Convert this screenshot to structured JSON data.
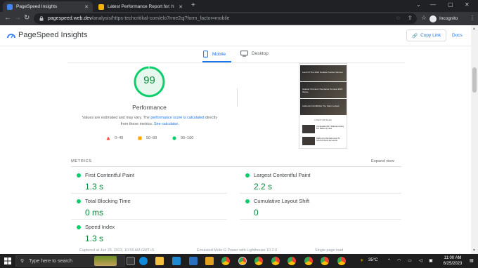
{
  "browser": {
    "tabs": [
      {
        "title": "PageSpeed Insights",
        "active": true
      },
      {
        "title": "Latest Performance Report for: h",
        "active": false
      }
    ],
    "url_host": "pagespeed.web.dev",
    "url_path": "/analysis/https-techcritikal-com/elo7rme2qj?form_factor=mobile",
    "profile_label": "Incognito"
  },
  "header": {
    "title": "PageSpeed Insights",
    "copy_link": "Copy Link",
    "docs": "Docs"
  },
  "device_tabs": {
    "mobile": "Mobile",
    "desktop": "Desktop"
  },
  "score": {
    "value": "99",
    "fraction": 0.99,
    "label": "Performance",
    "disclaimer_a": "Values are estimated and may vary. The ",
    "disclaimer_link1": "performance score is calculated",
    "disclaimer_b": " directly from these metrics. ",
    "disclaimer_link2": "See calculator.",
    "legend": [
      {
        "range": "0–49",
        "color": "#ff4e42"
      },
      {
        "range": "50–89",
        "color": "#ffa400"
      },
      {
        "range": "90–100",
        "color": "#0cce6b"
      }
    ]
  },
  "screenshot": {
    "cards": [
      "Land Of The 2023 Notable Positive Women",
      "Snarker Premium The Game To Face 2023 Series",
      "Authentic DroidMode The Stars Locked"
    ],
    "latest_label": "LATEST ARTICLES",
    "articles": [
      "Unmissable 2017 Pakistan Liberty Pro Slides Up Here",
      "Taking It to the Next Level To Arrive At Score As Low As"
    ]
  },
  "metrics": {
    "label": "METRICS",
    "expand": "Expand view",
    "items": [
      {
        "name": "First Contentful Paint",
        "value": "1.3 s"
      },
      {
        "name": "Largest Contentful Paint",
        "value": "2.2 s"
      },
      {
        "name": "Total Blocking Time",
        "value": "0 ms"
      },
      {
        "name": "Cumulative Layout Shift",
        "value": "0"
      },
      {
        "name": "Speed Index",
        "value": "1.3 s"
      }
    ],
    "footer": [
      "Captured at Jun 25, 2023, 10:59 AM GMT+5",
      "Emulated Moto G Power with Lighthouse 10.2.0",
      "Single page load"
    ]
  },
  "taskbar": {
    "search_placeholder": "Type here to search",
    "temperature": "35°C",
    "time": "11:00 AM",
    "date": "6/25/2023"
  },
  "colors": {
    "accent": "#1a73e8",
    "pass": "#0cce6b",
    "pass_text": "#0c8a3c"
  }
}
